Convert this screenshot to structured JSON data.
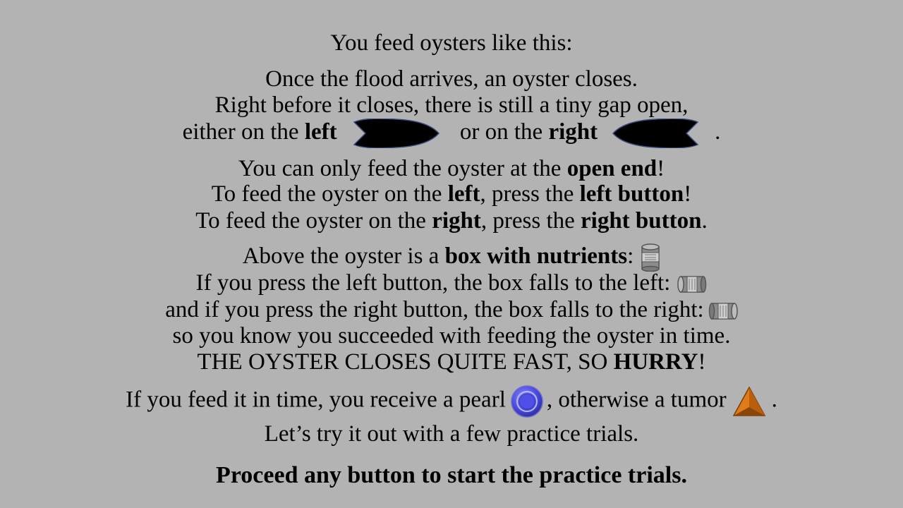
{
  "instructions": {
    "title": "You feed oysters like this:",
    "flood_line": "Once the flood arrives, an oyster closes.",
    "gap_line": "Right before it closes, there is still a tiny gap open,",
    "gap_line2": {
      "prefix": "either on the ",
      "left": "left",
      "middle": " or on the ",
      "right": "right",
      "suffix": "."
    },
    "open_end_line": {
      "prefix": "You can only feed the oyster at the ",
      "emph": "open end",
      "suffix": "!"
    },
    "feed_left_line": {
      "prefix": "To feed the oyster on the ",
      "emph1": "left",
      "middle": ", press the ",
      "emph2": "left button",
      "suffix": "!"
    },
    "feed_right_line": {
      "prefix": "To feed the oyster on the ",
      "emph1": "right",
      "middle": ", press the ",
      "emph2": "right button",
      "suffix": "."
    },
    "box_line": {
      "prefix": "Above the oyster is a ",
      "emph": "box with nutrients",
      "suffix": ":"
    },
    "box_left_line": "If you press the left button, the box falls to the left:",
    "box_right_line": "and if you press the right button, the box falls to the right:",
    "success_line": "so you know you succeeded with feeding the oyster in time.",
    "hurry_line": {
      "prefix": "THE OYSTER CLOSES QUITE FAST, SO ",
      "emph": "HURRY",
      "suffix": "!"
    },
    "reward_line": {
      "prefix": "If you feed it in time, you receive a pearl",
      "middle": ", otherwise a tumor",
      "suffix": "."
    },
    "practice_line": "Let’s try it out with a few practice trials.",
    "proceed_line": "Proceed any button to start the practice trials."
  },
  "icons": {
    "oyster_left": "oyster-open-left-icon",
    "oyster_right": "oyster-open-right-icon",
    "box": "nutrient-can-icon",
    "box_left": "can-fallen-left-icon",
    "box_right": "can-fallen-right-icon",
    "pearl": "pearl-icon",
    "tumor": "tumor-triangle-icon"
  },
  "colors": {
    "background": "#b3b3b3",
    "pearl": "#4a4ae0",
    "tumor": "#e07b1a"
  }
}
